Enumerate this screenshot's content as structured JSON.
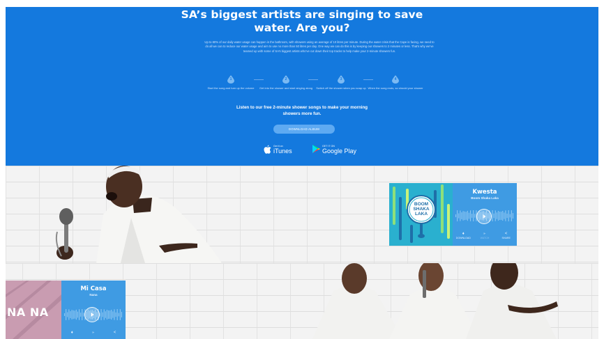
{
  "hero": {
    "title_line1": "SA’s biggest artists are singing to save",
    "title_line2": "water. Are you?",
    "intro": "Up to 80% of our daily water usage can happen in the bathroom, with showers using an average of 10 litres per minute. During the water crisis that the Cape is facing, we need to do all we can to reduce our water usage and aim to use no more than 50 litres per day. One way we can do this is by keeping our showers to 2 minutes or less. That’s why we’ve teamed up with some of SA’s biggest artists who’ve cut down their top tracks to help make your 2-minute showers fun.",
    "steps": [
      {
        "num": "1",
        "text": "Start the song and turn up the volume"
      },
      {
        "num": "2",
        "text": "Get into the shower and start singing along"
      },
      {
        "num": "3",
        "text": "Switch off the shower when you soap up"
      },
      {
        "num": "4",
        "text": "When the song ends, so should your shower"
      }
    ],
    "listen": "Listen to our free 2-minute shower songs to make your morning showers more fun.",
    "download_button": "DOWNLOAD ALBUM",
    "itunes": {
      "small": "Get it on",
      "big": "iTunes"
    },
    "google_play": {
      "small": "GET IT ON",
      "big": "Google Play"
    }
  },
  "cards": {
    "kwesta": {
      "name": "Kwesta",
      "song": "Boom Shaka Laka",
      "cover_text": [
        "BOOM",
        "SHAKA",
        "LAKA"
      ],
      "actions": [
        "DOWNLOAD",
        "WATCH",
        "SHARE"
      ]
    },
    "micasa": {
      "name": "Mi Casa",
      "song": "Nana",
      "cover_text": "NA NA"
    }
  },
  "colors": {
    "hero_bg": "#1479de",
    "card_bg": "#3f9be3",
    "button_bg": "#5eaaf2"
  }
}
